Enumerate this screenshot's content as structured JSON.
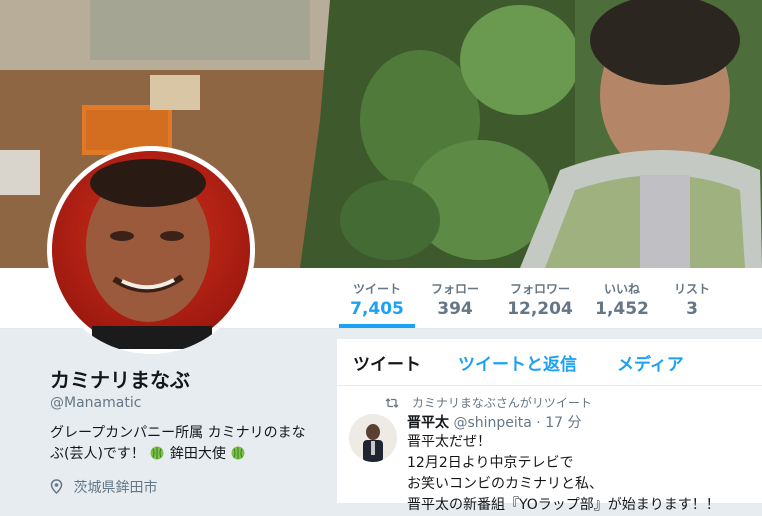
{
  "stats": [
    {
      "label": "ツイート",
      "value": "7,405",
      "active": true
    },
    {
      "label": "フォロー",
      "value": "394",
      "active": false
    },
    {
      "label": "フォロワー",
      "value": "12,204",
      "active": false
    },
    {
      "label": "いいね",
      "value": "1,452",
      "active": false
    },
    {
      "label": "リスト",
      "value": "3",
      "active": false
    }
  ],
  "profile": {
    "name": "カミナリまなぶ",
    "handle": "@Manamatic",
    "bio_line1": "グレープカンパニー所属 カミナリのまな",
    "bio_line2_a": "ぶ(芸人)です！",
    "bio_line2_b": "鉾田大使",
    "location": "茨城県鉾田市"
  },
  "timeline": {
    "tabs": [
      "ツイート",
      "ツイートと返信",
      "メディア"
    ],
    "tweet": {
      "retweet_context": "カミナリまなぶさんがリツイート",
      "fullname": "晋平太",
      "username": "@shinpeita",
      "dot": "·",
      "time": "17 分",
      "lines": [
        "晋平太だぜ！",
        "12月2日より中京テレビで",
        "お笑いコンビのカミナリと私、",
        "晋平太の新番組『YOラップ部』が始まります！！"
      ]
    }
  },
  "colors": {
    "accent": "#1da1f2",
    "secondary_text": "#657786",
    "primary_text": "#14171a",
    "page_background": "#e6ecf0"
  },
  "icons": {
    "melon": "melon-icon",
    "location": "location-pin-icon",
    "retweet": "retweet-icon"
  }
}
